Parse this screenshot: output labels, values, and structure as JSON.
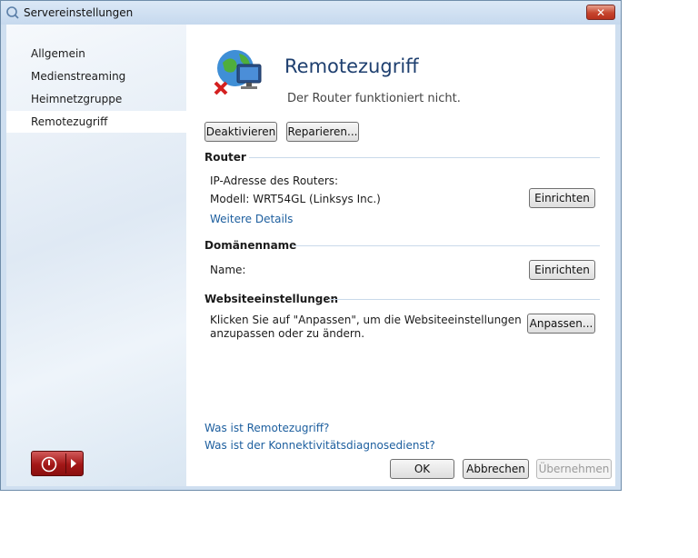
{
  "window": {
    "title": "Servereinstellungen",
    "close_glyph": "✕"
  },
  "sidebar": {
    "items": [
      {
        "label": "Allgemein"
      },
      {
        "label": "Medienstreaming"
      },
      {
        "label": "Heimnetzgruppe"
      },
      {
        "label": "Remotezugriff",
        "active": true
      }
    ]
  },
  "hero": {
    "title": "Remotezugriff",
    "status": "Der Router funktioniert nicht.",
    "icon": "globe-computer-error-icon"
  },
  "actions": {
    "deactivate": "Deaktivieren",
    "repair": "Reparieren..."
  },
  "router": {
    "heading": "Router",
    "ip_label": "IP-Adresse des Routers:",
    "model_label": "Modell: WRT54GL (Linksys Inc.)",
    "setup": "Einrichten",
    "details_link": "Weitere Details"
  },
  "domain": {
    "heading": "Domänenname",
    "name_label": "Name:",
    "setup": "Einrichten"
  },
  "website": {
    "heading": "Websiteeinstellungen",
    "desc_line1": "Klicken Sie auf \"Anpassen\", um die Websiteeinstellungen",
    "desc_line2": "anzupassen oder zu ändern.",
    "customize": "Anpassen..."
  },
  "links": {
    "what_is": "Was ist Remotezugriff?",
    "diag": "Was ist der Konnektivitätsdiagnosedienst?"
  },
  "footer": {
    "ok": "OK",
    "cancel": "Abbrechen",
    "apply": "Übernehmen"
  },
  "colors": {
    "title_blue": "#1e3f6f",
    "link_blue": "#1c5e9e",
    "power_red": "#a31717"
  }
}
